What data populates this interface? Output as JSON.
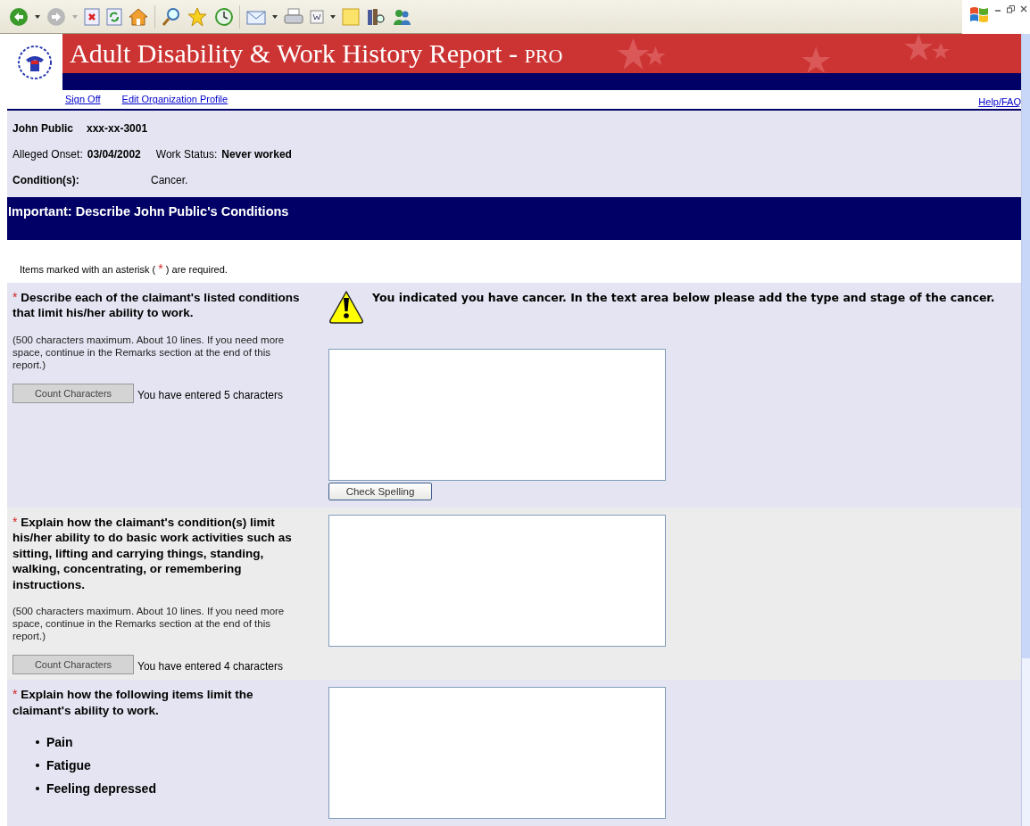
{
  "banner": {
    "title": "Adult Disability & Work History Report - ",
    "title_suffix": "PRO"
  },
  "nav": {
    "links": [
      "Sign Off",
      "Edit Organization Profile"
    ],
    "help": "Help/FAQ"
  },
  "claimant": {
    "name": "John Public",
    "ssn": "xxx-xx-3001",
    "onset_label": "Alleged Onset:",
    "onset": "03/04/2002",
    "work_status_label": "Work Status:",
    "work_status": "Never worked",
    "conditions_label": "Condition(s):",
    "conditions": "Cancer."
  },
  "section_header": "Important: Describe John Public's Conditions",
  "required_note": {
    "before": "Items marked with an asterisk (",
    "mark": "*",
    "after": ") are required."
  },
  "questions": [
    {
      "asterisk": "*",
      "question": "Describe each of the claimant's listed conditions that limit his/her ability to work.",
      "warning": "You indicated you have cancer. In the text area below please add the type and stage of the cancer.",
      "hint": "(500 characters maximum. About 10 lines. If you need more space, continue in the Remarks section at the end of this report.)",
      "count_button": "Count Characters",
      "count_text": "You have entered 5 characters",
      "spell_button": "Check Spelling"
    },
    {
      "asterisk": "*",
      "question": "Explain how the claimant's condition(s) limit his/her ability to do basic work activities such as sitting, lifting and carrying things, standing, walking, concentrating, or remembering instructions.",
      "hint": "(500 characters maximum. About 10 lines. If you need more space, continue in the Remarks section at the end of this report.)",
      "count_button": "Count Characters",
      "count_text": "You have entered 4 characters"
    },
    {
      "asterisk": "*",
      "question": "Explain how the following items limit the claimant's ability to work.",
      "bullets": [
        "Pain",
        "Fatigue",
        "Feeling depressed"
      ]
    }
  ]
}
